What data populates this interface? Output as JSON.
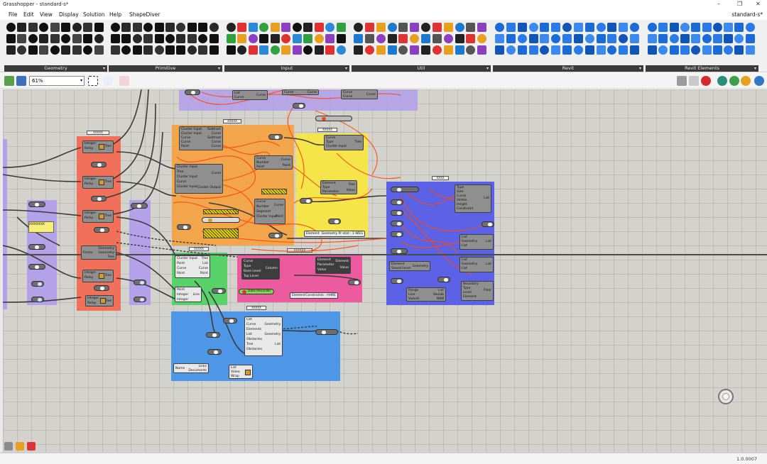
{
  "window": {
    "title": "Grasshopper - standard-s*",
    "document_tab": "standard-s*",
    "controls": [
      "–",
      "❐",
      "✕"
    ]
  },
  "menu": {
    "items": [
      "File",
      "Edit",
      "View",
      "Display",
      "Solution",
      "Help",
      "ShapeDiver"
    ]
  },
  "ribbon": {
    "groups": [
      {
        "label": "Geometry"
      },
      {
        "label": "Primitive"
      },
      {
        "label": "Input"
      },
      {
        "label": "Util"
      },
      {
        "label": "Revit"
      },
      {
        "label": "Revit Elements"
      }
    ],
    "small_labels": {
      "xyz": "XYZ",
      "shp": "SHP",
      "num20": "20",
      "fx": "f(x)",
      "pdf": "PDF",
      "3dm": "3DM"
    }
  },
  "canvas_toolbar": {
    "zoom_value": "61%",
    "zoom_caret": "▾"
  },
  "canvas": {
    "group_labels": {
      "top_purple": "",
      "orange": "XXXXX",
      "yellow": "XXXXX",
      "blue_right": "XXXX",
      "green": "XXXXX",
      "pink": "XXXXXX",
      "blue_bottom": "XXXXX",
      "red_left": "XXXXX"
    },
    "components": {
      "cluster_a": {
        "ins": [
          "Cluster Input",
          "Cluster Input",
          "Curve",
          "Curve",
          "Point"
        ],
        "outs": [
          "Subtract",
          "Curve",
          "Subtract",
          "Curve",
          "Curve"
        ]
      },
      "cluster_b": {
        "ins": [
          "Cluster Input",
          "Tree",
          "Cluster Input",
          "Curve",
          "Cluster Input"
        ],
        "outs": [
          "Curve",
          "Cluster Output"
        ]
      },
      "curve_c": {
        "ins": [
          "Curve",
          "Number",
          "Point"
        ],
        "outs": [
          "Curve",
          "Point"
        ]
      },
      "curve_d": {
        "ins": [
          "Curve",
          "Number",
          "Segment",
          "Cluster Input"
        ],
        "outs": [
          "Curve",
          "Point"
        ]
      },
      "curve_yellow": {
        "ins": [
          "Curve",
          "Type",
          "Cluster Input"
        ],
        "outs": [
          "Tree"
        ]
      },
      "element_y": {
        "ins": [
          "Element",
          "Type",
          "Parameter"
        ],
        "outs": [
          "Tree",
          "Value"
        ]
      },
      "geometry_filter": {
        "label": "Element",
        "value": "Geometry Pr otat : 1 WEG"
      },
      "int_tree_1": {
        "ins": [
          "Integer",
          "Relay"
        ],
        "out": "Tree"
      },
      "int_tree_2": {
        "ins": [
          "Integer",
          "Relay"
        ],
        "out": "Tree"
      },
      "int_tree_3": {
        "ins": [
          "Integer",
          "Relay"
        ],
        "out": "Tree"
      },
      "geom_tree": {
        "ins": [
          "Factor"
        ],
        "outs": [
          "Geometry",
          "Geometry",
          "Tree"
        ]
      },
      "int_tree_4": {
        "ins": [
          "Integer",
          "Relay"
        ],
        "out": "Tree"
      },
      "int_tree_5": {
        "ins": [
          "Integer",
          "Relay"
        ],
        "out": "Tree"
      },
      "cluster_green": {
        "ins": [
          "Cluster Input",
          "Point",
          "Curve",
          "Point"
        ],
        "outs": [
          "Tree",
          "List",
          "Curve",
          "Point"
        ]
      },
      "line_green": {
        "ins": [
          "Point",
          "Integer",
          "Integer"
        ],
        "out": "Line"
      },
      "column": {
        "ins": [
          "Curve",
          "Type",
          "Base Level",
          "Top Level"
        ],
        "out": "Column"
      },
      "element_param": {
        "ins": [
          "Element",
          "Parameter",
          "Value"
        ],
        "outs": [
          "Element",
          "Value"
        ]
      },
      "data_recorder": {
        "label": "Data Recorder"
      },
      "constraints": {
        "label": "Element",
        "value": "Constraints : HHRE"
      },
      "blue_big": {
        "ins": [
          "List",
          "Curve",
          "Elements",
          "List",
          "Obstacles",
          "Tree",
          "Obstacles"
        ],
        "outs": [
          "Geometry",
          "Geometry",
          "List"
        ]
      },
      "links": {
        "ins": [
          "Name"
        ],
        "outs": [
          "Links",
          "Documents"
        ]
      },
      "list_video": {
        "ins": [
          "List",
          "Video",
          "Wrap"
        ]
      },
      "bhop": {
        "ins": [
          "Type",
          "Size",
          "Curve",
          "Vertex",
          "Height",
          "Constraint"
        ],
        "out": "List"
      },
      "list_geo_1": {
        "ins": [
          "List",
          "Geometry",
          "List"
        ],
        "out": "List"
      },
      "list_geo_2": {
        "ins": [
          "List",
          "Geometry",
          "List"
        ],
        "out": "List"
      },
      "element_geo": {
        "ins": [
          "Element",
          "Saved Level"
        ],
        "out": "Geometry"
      },
      "line_vals": {
        "ins": [
          "Range",
          "Line",
          "Vwerel"
        ],
        "outs": [
          "List",
          "Vaulab",
          "NNN"
        ]
      },
      "boundary": {
        "ins": [
          "Boundary",
          "Type",
          "Level",
          "Element"
        ],
        "out": "Floor"
      },
      "top_a": {
        "ins": [
          "List",
          "Curve"
        ],
        "out": "Curve"
      },
      "top_b": {
        "ins": [
          "Curve"
        ],
        "out": "Curve"
      },
      "top_c": {
        "ins": [
          "Curve",
          "Curve"
        ],
        "out": "Curve"
      },
      "panel_yellow_text": "XXXXXXXX",
      "scribble": "Geometry Filter"
    }
  },
  "status": {
    "version": "1.0.0007"
  },
  "colors": {
    "canvas": "#d4d2cc",
    "group_purple": "#b4a2e8",
    "group_orange": "#f2a54a",
    "group_yellow": "#f5e54a",
    "group_blue": "#5b62e6",
    "group_green": "#59d26a",
    "group_pink": "#ec5aa0",
    "group_blue_bottom": "#4e96e6",
    "group_red": "#f0705a",
    "wire_orange": "#ff4a10",
    "wire_dark": "#3a3a3a"
  }
}
